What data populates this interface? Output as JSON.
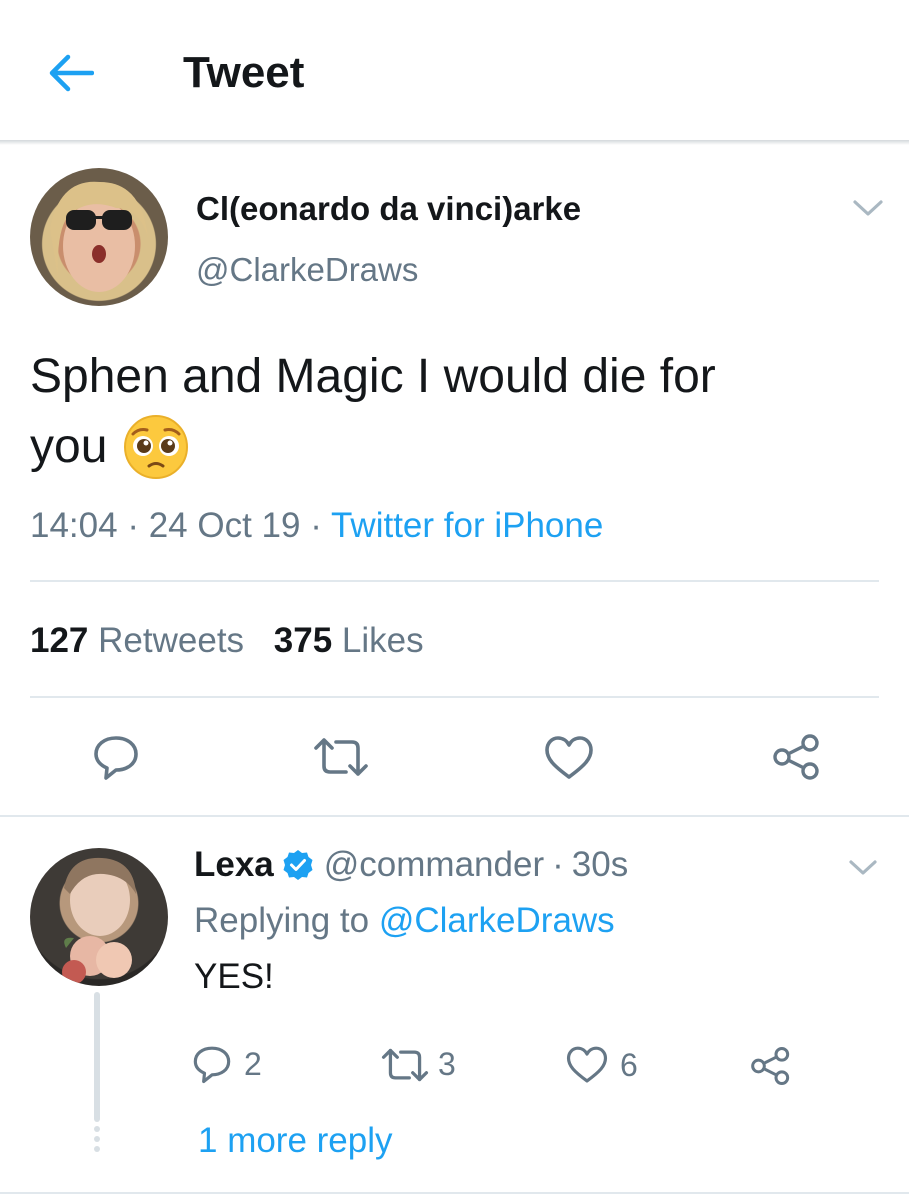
{
  "header": {
    "title": "Tweet",
    "back_icon": "arrow-left-icon"
  },
  "tweet": {
    "display_name": "Cl(eonardo da vinci)arke",
    "handle": "@ClarkeDraws",
    "text_line1": "Sphen and Magic I would die for",
    "text_line2": "you",
    "emoji": "🥺",
    "time": "14:04",
    "separator": "·",
    "date": "24 Oct 19",
    "source": "Twitter for iPhone",
    "retweets_count": "127",
    "retweets_label": "Retweets",
    "likes_count": "375",
    "likes_label": "Likes"
  },
  "reply": {
    "display_name": "Lexa",
    "handle": "@commander",
    "separator": "·",
    "age": "30s",
    "replying_to_label": "Replying to",
    "replying_to_handle": "@ClarkeDraws",
    "text": "YES!",
    "reply_count": "2",
    "retweet_count": "3",
    "like_count": "6",
    "more_replies": "1 more reply"
  },
  "colors": {
    "accent": "#1da1f2",
    "text": "#14171a",
    "muted": "#657786",
    "divider": "#e1e8ed"
  }
}
